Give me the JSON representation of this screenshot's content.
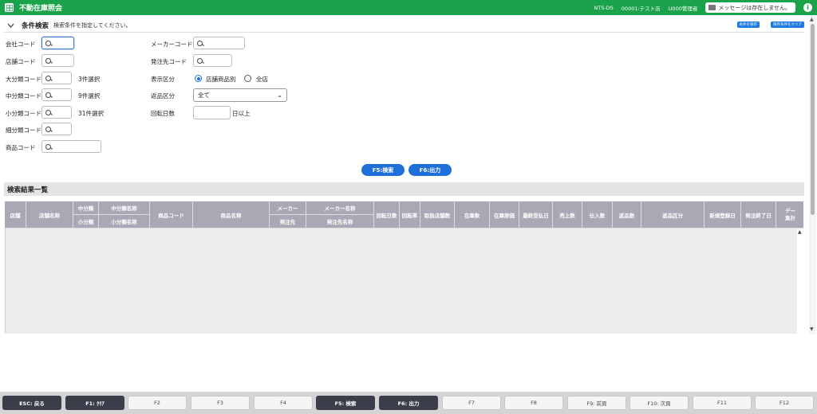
{
  "header": {
    "title": "不動在庫照会",
    "system": "NTS-DS",
    "store": "00001:テスト店",
    "user": "U000管理者",
    "message": "メッセージは存在しません。",
    "info_icon": "i"
  },
  "conditions": {
    "title": "条件検索",
    "hint": "検索条件を指定してください。",
    "save_label": "条件を保存",
    "clear_label": "保存条件をクリア"
  },
  "form": {
    "company_code": "会社コード",
    "store_code": "店舗コード",
    "major_code": "大分類コード",
    "major_count": "3件選択",
    "middle_code": "中分類コード",
    "middle_count": "9件選択",
    "minor_code": "小分類コード",
    "minor_count": "31件選択",
    "fine_code": "細分類コード",
    "product_code": "商品コード",
    "maker_code": "メーカーコード",
    "supplier_code": "発注先コード",
    "display_type": "表示区分",
    "display_opt1": "店舗商品別",
    "display_opt2": "全店",
    "return_type": "返品区分",
    "return_value": "全て",
    "turnover_days": "回転日数",
    "turnover_suffix": "日以上"
  },
  "actions": {
    "search": "F5:検索",
    "output": "F6:出力"
  },
  "results": {
    "title": "検索結果一覧",
    "headers": {
      "store": "店舗",
      "store_name": "店舗名称",
      "mid_cat": "中分類",
      "mid_cat_name": "中分類名称",
      "small_cat": "小分類",
      "small_cat_name": "小分類名称",
      "product_code": "商品コード",
      "product_name": "商品名称",
      "maker": "メーカー",
      "maker_name": "メーカー名称",
      "supplier": "発注先",
      "supplier_name": "発注先名称",
      "turn_days": "回転日数",
      "turn_rate": "回転率",
      "stores_count": "取扱店舗数",
      "stock_qty": "在庫数",
      "stock_cost": "在庫原価",
      "last_recv": "最終受払日",
      "sales_qty": "売上数",
      "purchase_qty": "仕入数",
      "return_qty": "返品数",
      "return_type": "返品区分",
      "new_reg": "新規登録日",
      "order_end": "発注終了日",
      "data_agg1": "デー",
      "data_agg2": "集計"
    }
  },
  "fkeys": [
    {
      "label": "ESC: 戻る",
      "active": true
    },
    {
      "label": "F1: ｸﾘｱ",
      "active": true
    },
    {
      "label": "F2",
      "active": false
    },
    {
      "label": "F3",
      "active": false
    },
    {
      "label": "F4",
      "active": false
    },
    {
      "label": "F5: 検索",
      "active": true
    },
    {
      "label": "F6: 出力",
      "active": true
    },
    {
      "label": "F7",
      "active": false
    },
    {
      "label": "F8",
      "active": false
    },
    {
      "label": "F9: 前頁",
      "active": false
    },
    {
      "label": "F10: 次頁",
      "active": false
    },
    {
      "label": "F11",
      "active": false
    },
    {
      "label": "F12",
      "active": false
    }
  ]
}
